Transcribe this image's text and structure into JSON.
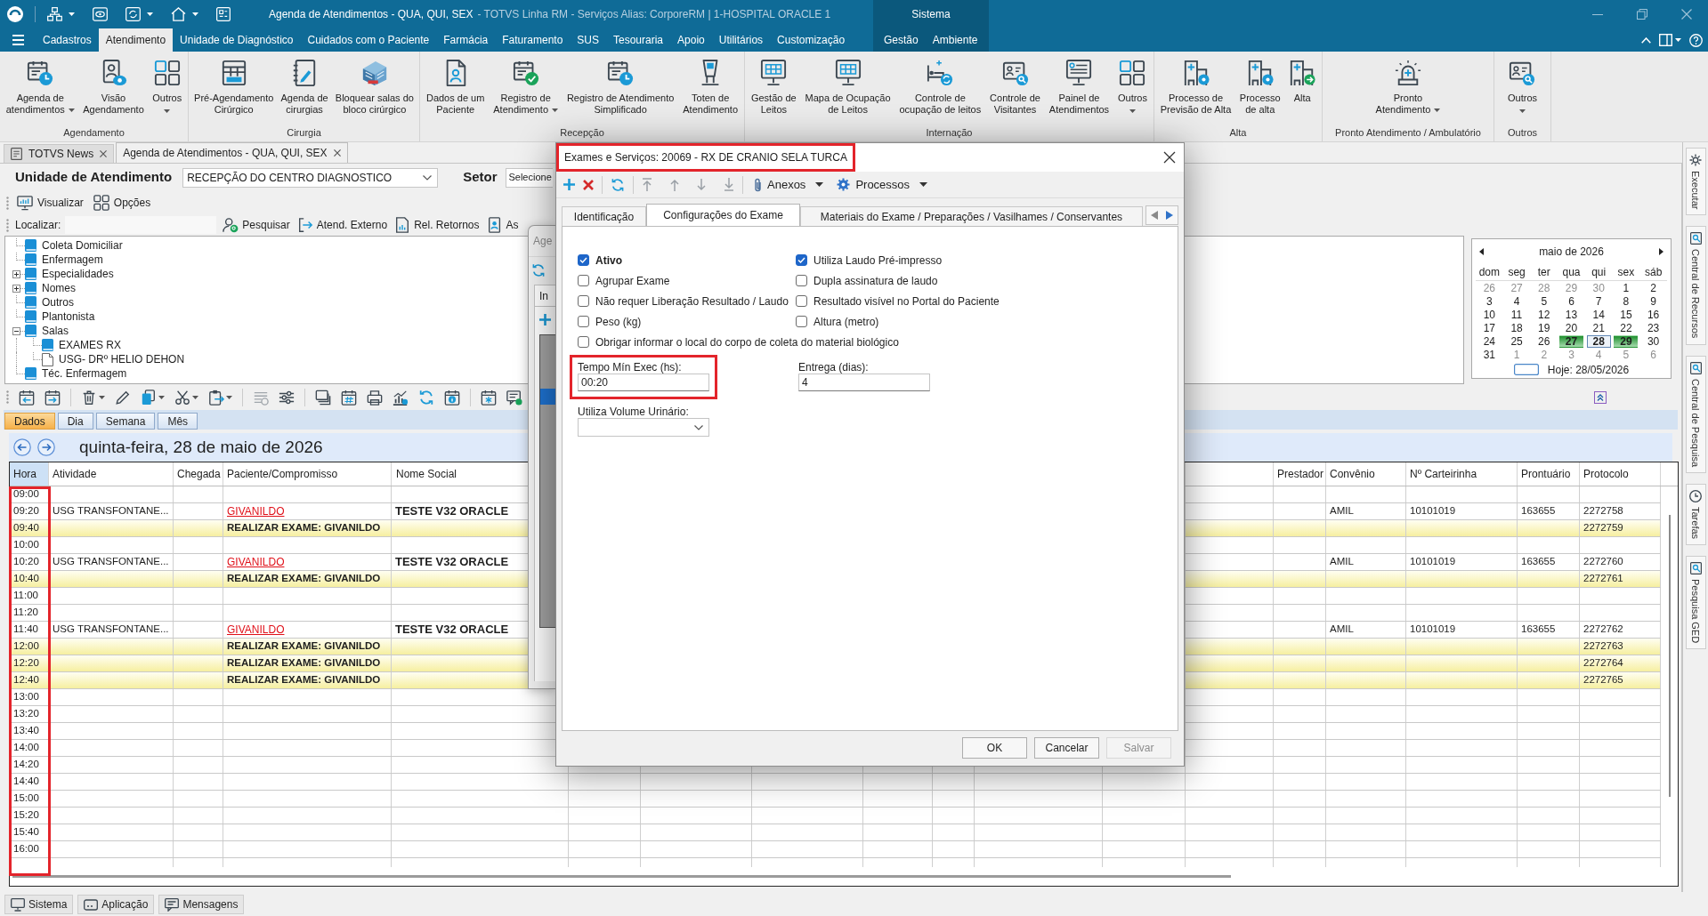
{
  "title_bar": {
    "title": "Agenda de Atendimentos - QUA, QUI, SEX",
    "subtitle": "- TOTVS Linha RM - Serviços Alias: CorporeRM | 1-HOSPITAL ORACLE 1"
  },
  "menu": [
    {
      "label": "Cadastros",
      "selected": false
    },
    {
      "label": "Atendimento",
      "selected": true
    },
    {
      "label": "Unidade de Diagnóstico",
      "selected": false
    },
    {
      "label": "Cuidados com o Paciente",
      "selected": false
    },
    {
      "label": "Farmácia",
      "selected": false
    },
    {
      "label": "Faturamento",
      "selected": false
    },
    {
      "label": "SUS",
      "selected": false
    },
    {
      "label": "Tesouraria",
      "selected": false
    },
    {
      "label": "Apoio",
      "selected": false
    },
    {
      "label": "Utilitários",
      "selected": false
    },
    {
      "label": "Customização",
      "selected": false
    }
  ],
  "context_group": {
    "label": "Sistema",
    "tabs": [
      {
        "label": "Gestão",
        "selected": false
      },
      {
        "label": "Ambiente",
        "selected": false
      }
    ]
  },
  "ribbon": [
    {
      "label": "Agendamento",
      "items": [
        {
          "label": "Agenda de\natendimentos",
          "dropdown": true
        },
        {
          "label": "Visão\nAgendamento",
          "dropdown": false
        },
        {
          "label": "Outros",
          "dropdown": true
        }
      ]
    },
    {
      "label": "Cirurgia",
      "items": [
        {
          "label": "Pré-Agendamento\nCirúrgico",
          "dropdown": false
        },
        {
          "label": "Agenda de\ncirurgias",
          "dropdown": false
        },
        {
          "label": "Bloquear salas do\nbloco cirúrgico",
          "dropdown": false
        }
      ]
    },
    {
      "label": "Recepção",
      "items": [
        {
          "label": "Dados de um\nPaciente",
          "dropdown": false
        },
        {
          "label": "Registro de\nAtendimento",
          "dropdown": true
        },
        {
          "label": "Registro de Atendimento\nSimplificado",
          "dropdown": false
        },
        {
          "label": "Toten de\nAtendimento",
          "dropdown": false
        }
      ]
    },
    {
      "label": "Internação",
      "items": [
        {
          "label": "Gestão de\nLeitos",
          "dropdown": false
        },
        {
          "label": "Mapa de Ocupação\nde Leitos",
          "dropdown": false
        },
        {
          "label": "Controle de\nocupação de leitos",
          "dropdown": false
        },
        {
          "label": "Controle de\nVisitantes",
          "dropdown": false
        },
        {
          "label": "Painel de\nAtendimentos",
          "dropdown": false
        },
        {
          "label": "Outros",
          "dropdown": true
        }
      ]
    },
    {
      "label": "Alta",
      "items": [
        {
          "label": "Processo de\nPrevisão de Alta",
          "dropdown": false
        },
        {
          "label": "Processo\nde alta",
          "dropdown": false
        },
        {
          "label": "Alta",
          "dropdown": false
        }
      ]
    },
    {
      "label": "Pronto Atendimento / Ambulatório",
      "items": [
        {
          "label": "Pronto\nAtendimento",
          "dropdown": true
        }
      ]
    },
    {
      "label": "Outros",
      "items": [
        {
          "label": "Outros",
          "dropdown": true
        }
      ]
    }
  ],
  "document_tabs": [
    {
      "label": "TOTVS News",
      "selected": false
    },
    {
      "label": "Agenda de Atendimentos - QUA, QUI, SEX",
      "selected": true
    }
  ],
  "unit_filter": {
    "label": "Unidade de Atendimento",
    "value": "RECEPÇÃO DO CENTRO DIAGNOSTICO"
  },
  "sector_filter": {
    "label": "Setor",
    "value": "Selecione"
  },
  "view_toolbar": [
    "Visualizar",
    "Opções"
  ],
  "search_bar": {
    "label": "Localizar:",
    "actions": [
      "Pesquisar",
      "Atend. Externo",
      "Rel. Retornos",
      "As"
    ]
  },
  "tree": [
    {
      "label": "Coleta Domiciliar",
      "kind": "book",
      "selected": false
    },
    {
      "label": "Enfermagem",
      "kind": "book",
      "selected": false
    },
    {
      "label": "Especialidades",
      "kind": "book",
      "selected": false,
      "expanded": false
    },
    {
      "label": "Nomes",
      "kind": "book",
      "selected": false,
      "expanded": false
    },
    {
      "label": "Outros",
      "kind": "book",
      "selected": false
    },
    {
      "label": "Plantonista",
      "kind": "book",
      "selected": false
    },
    {
      "label": "Salas",
      "kind": "book",
      "selected": false,
      "expanded": true,
      "children": [
        {
          "label": "EXAMES RX",
          "kind": "book",
          "selected": false
        },
        {
          "label": "USG- DRº HELIO DEHON",
          "kind": "page",
          "selected": false
        }
      ]
    },
    {
      "label": "Téc. Enfermagem",
      "kind": "book",
      "selected": false
    }
  ],
  "calendar": {
    "title": "maio de 2026",
    "weekdays": [
      "dom",
      "seg",
      "ter",
      "qua",
      "qui",
      "sex",
      "sáb"
    ],
    "weeks": [
      [
        {
          "day": "26",
          "other_month": true,
          "marked": false,
          "selected": false
        },
        {
          "day": "27",
          "other_month": true,
          "marked": false,
          "selected": false
        },
        {
          "day": "28",
          "other_month": true,
          "marked": false,
          "selected": false
        },
        {
          "day": "29",
          "other_month": true,
          "marked": false,
          "selected": false
        },
        {
          "day": "30",
          "other_month": true,
          "marked": false,
          "selected": false
        },
        {
          "day": "1",
          "other_month": false,
          "marked": false,
          "selected": false
        },
        {
          "day": "2",
          "other_month": false,
          "marked": false,
          "selected": false
        }
      ],
      [
        {
          "day": "3",
          "other_month": false,
          "marked": false,
          "selected": false
        },
        {
          "day": "4",
          "other_month": false,
          "marked": false,
          "selected": false
        },
        {
          "day": "5",
          "other_month": false,
          "marked": false,
          "selected": false
        },
        {
          "day": "6",
          "other_month": false,
          "marked": false,
          "selected": false
        },
        {
          "day": "7",
          "other_month": false,
          "marked": false,
          "selected": false
        },
        {
          "day": "8",
          "other_month": false,
          "marked": false,
          "selected": false
        },
        {
          "day": "9",
          "other_month": false,
          "marked": false,
          "selected": false
        }
      ],
      [
        {
          "day": "10",
          "other_month": false,
          "marked": false,
          "selected": false
        },
        {
          "day": "11",
          "other_month": false,
          "marked": false,
          "selected": false
        },
        {
          "day": "12",
          "other_month": false,
          "marked": false,
          "selected": false
        },
        {
          "day": "13",
          "other_month": false,
          "marked": false,
          "selected": false
        },
        {
          "day": "14",
          "other_month": false,
          "marked": false,
          "selected": false
        },
        {
          "day": "15",
          "other_month": false,
          "marked": false,
          "selected": false
        },
        {
          "day": "16",
          "other_month": false,
          "marked": false,
          "selected": false
        }
      ],
      [
        {
          "day": "17",
          "other_month": false,
          "marked": false,
          "selected": false
        },
        {
          "day": "18",
          "other_month": false,
          "marked": false,
          "selected": false
        },
        {
          "day": "19",
          "other_month": false,
          "marked": false,
          "selected": false
        },
        {
          "day": "20",
          "other_month": false,
          "marked": false,
          "selected": false
        },
        {
          "day": "21",
          "other_month": false,
          "marked": false,
          "selected": false
        },
        {
          "day": "22",
          "other_month": false,
          "marked": false,
          "selected": false
        },
        {
          "day": "23",
          "other_month": false,
          "marked": false,
          "selected": false
        }
      ],
      [
        {
          "day": "24",
          "other_month": false,
          "marked": false,
          "selected": false
        },
        {
          "day": "25",
          "other_month": false,
          "marked": false,
          "selected": false
        },
        {
          "day": "26",
          "other_month": false,
          "marked": false,
          "selected": false
        },
        {
          "day": "27",
          "other_month": false,
          "marked": true,
          "selected": false
        },
        {
          "day": "28",
          "other_month": false,
          "marked": false,
          "selected": true
        },
        {
          "day": "29",
          "other_month": false,
          "marked": true,
          "selected": false
        },
        {
          "day": "30",
          "other_month": false,
          "marked": false,
          "selected": false
        }
      ],
      [
        {
          "day": "31",
          "other_month": false,
          "marked": false,
          "selected": false
        },
        {
          "day": "1",
          "other_month": true,
          "marked": false,
          "selected": false
        },
        {
          "day": "2",
          "other_month": true,
          "marked": false,
          "selected": false
        },
        {
          "day": "3",
          "other_month": true,
          "marked": false,
          "selected": false
        },
        {
          "day": "4",
          "other_month": true,
          "marked": false,
          "selected": false
        },
        {
          "day": "5",
          "other_month": true,
          "marked": false,
          "selected": false
        },
        {
          "day": "6",
          "other_month": true,
          "marked": false,
          "selected": false
        }
      ]
    ],
    "today_label": "Hoje: 28/05/2026"
  },
  "view_tabs": [
    {
      "label": "Dados",
      "selected": true
    },
    {
      "label": "Dia",
      "selected": false
    },
    {
      "label": "Semana",
      "selected": false
    },
    {
      "label": "Mês",
      "selected": false
    }
  ],
  "date_heading": "quinta-feira, 28 de maio de 2026",
  "schedule": {
    "hora_highlighted": true,
    "columns": [
      {
        "label": "Hora",
        "selected": true
      },
      {
        "label": "Atividade",
        "selected": false
      },
      {
        "label": "Chegada",
        "selected": false
      },
      {
        "label": "Paciente/Compromisso",
        "selected": false
      },
      {
        "label": "Nome Social",
        "selected": false
      },
      {
        "label": "Prestador",
        "selected": false
      },
      {
        "label": "Convênio",
        "selected": false
      },
      {
        "label": "Nº Carteirinha",
        "selected": false
      },
      {
        "label": "Prontuário",
        "selected": false
      },
      {
        "label": "Protocolo",
        "selected": false
      }
    ],
    "rows": [
      {
        "kind": "free",
        "hora": "09:00"
      },
      {
        "kind": "appointment",
        "hora": "09:20",
        "atividade": "USG TRANSFONTANE...",
        "paciente": "GIVANILDO",
        "nome_social": "TESTE V32 ORACLE",
        "convenio": "AMIL",
        "carteirinha": "10101019",
        "prontuario": "163655",
        "protocolo": "2272758"
      },
      {
        "kind": "task",
        "hora": "09:40",
        "paciente": "REALIZAR EXAME: GIVANILDO",
        "protocolo": "2272759"
      },
      {
        "kind": "free",
        "hora": "10:00"
      },
      {
        "kind": "appointment",
        "hora": "10:20",
        "atividade": "USG TRANSFONTANE...",
        "paciente": "GIVANILDO",
        "nome_social": "TESTE V32 ORACLE",
        "convenio": "AMIL",
        "carteirinha": "10101019",
        "prontuario": "163655",
        "protocolo": "2272760"
      },
      {
        "kind": "task",
        "hora": "10:40",
        "paciente": "REALIZAR EXAME: GIVANILDO",
        "protocolo": "2272761"
      },
      {
        "kind": "free",
        "hora": "11:00"
      },
      {
        "kind": "free",
        "hora": "11:20"
      },
      {
        "kind": "appointment",
        "hora": "11:40",
        "atividade": "USG TRANSFONTANE...",
        "paciente": "GIVANILDO",
        "nome_social": "TESTE V32 ORACLE",
        "convenio": "AMIL",
        "carteirinha": "10101019",
        "prontuario": "163655",
        "protocolo": "2272762"
      },
      {
        "kind": "task",
        "hora": "12:00",
        "paciente": "REALIZAR EXAME: GIVANILDO",
        "protocolo": "2272763"
      },
      {
        "kind": "task",
        "hora": "12:20",
        "paciente": "REALIZAR EXAME: GIVANILDO",
        "protocolo": "2272764"
      },
      {
        "kind": "task",
        "hora": "12:40",
        "paciente": "REALIZAR EXAME: GIVANILDO",
        "protocolo": "2272765"
      },
      {
        "kind": "free",
        "hora": "13:00"
      },
      {
        "kind": "free",
        "hora": "13:20"
      },
      {
        "kind": "free",
        "hora": "13:40"
      },
      {
        "kind": "free",
        "hora": "14:00"
      },
      {
        "kind": "free",
        "hora": "14:20"
      },
      {
        "kind": "free",
        "hora": "14:40"
      },
      {
        "kind": "free",
        "hora": "15:00"
      },
      {
        "kind": "free",
        "hora": "15:20"
      },
      {
        "kind": "free",
        "hora": "15:40"
      },
      {
        "kind": "free",
        "hora": "16:00"
      }
    ]
  },
  "background_window": {
    "title": "Age",
    "tab": "In"
  },
  "dialog": {
    "title": "Exames e Serviços: 20069 - RX DE CRANIO SELA TURCA",
    "title_highlighted": true,
    "menus": [
      "Anexos",
      "Processos"
    ],
    "tabs": [
      {
        "label": "Identificação",
        "selected": false
      },
      {
        "label": "Configurações do Exame",
        "selected": true
      },
      {
        "label": "Materiais do Exame / Preparações / Vasilhames / Conservantes",
        "selected": false
      }
    ],
    "checkboxes": [
      {
        "label": "Ativo",
        "checked": true,
        "emphasized": true
      },
      {
        "label": "Utiliza Laudo Pré-impresso",
        "checked": true,
        "emphasized": false
      },
      {
        "label": "Agrupar Exame",
        "checked": false,
        "emphasized": false
      },
      {
        "label": "Dupla assinatura de laudo",
        "checked": false,
        "emphasized": false
      },
      {
        "label": "Não requer Liberação Resultado / Laudo",
        "checked": false,
        "emphasized": false
      },
      {
        "label": "Resultado visível no Portal do Paciente",
        "checked": false,
        "emphasized": false
      },
      {
        "label": "Peso (kg)",
        "checked": false,
        "emphasized": false
      },
      {
        "label": "Altura (metro)",
        "checked": false,
        "emphasized": false
      },
      {
        "label": "Obrigar informar o local do corpo de coleta do material biológico",
        "checked": false,
        "emphasized": false
      }
    ],
    "fields": [
      {
        "label": "Tempo Mín Exec (hs):",
        "value": "00:20",
        "highlighted": true
      },
      {
        "label": "Entrega (dias):",
        "value": "4",
        "highlighted": false
      }
    ],
    "select": {
      "label": "Utiliza Volume Urinário:"
    },
    "buttons": [
      {
        "label": "OK",
        "disabled": false
      },
      {
        "label": "Cancelar",
        "disabled": false
      },
      {
        "label": "Salvar",
        "disabled": true
      }
    ]
  },
  "status_tabs": [
    "Sistema",
    "Aplicação",
    "Mensagens"
  ],
  "side_tabs": [
    "Executar",
    "Central de Recursos",
    "Central de Pesquisa",
    "Tarefas",
    "Pesquisa GED"
  ]
}
